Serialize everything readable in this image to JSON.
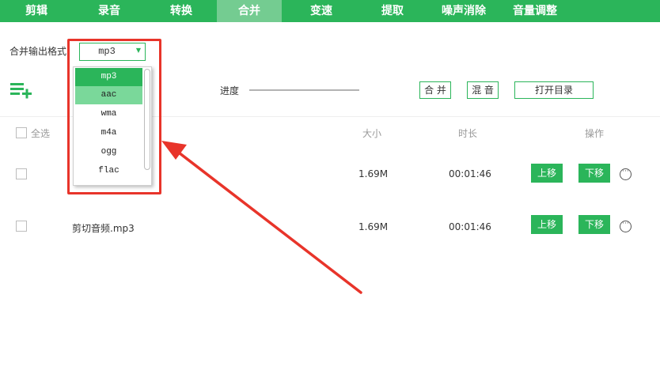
{
  "tabs": [
    {
      "label": "剪辑"
    },
    {
      "label": "录音"
    },
    {
      "label": "转换"
    },
    {
      "label": "合并",
      "active": true
    },
    {
      "label": "变速"
    },
    {
      "label": "提取"
    },
    {
      "label": "噪声消除"
    },
    {
      "label": "音量调整"
    }
  ],
  "format": {
    "label": "合并输出格式",
    "selected": "mp3"
  },
  "dropdown": {
    "options": [
      "mp3",
      "aac",
      "wma",
      "m4a",
      "ogg",
      "flac"
    ],
    "selected": "mp3",
    "hovered": "aac"
  },
  "toolbar": {
    "add_icon": "add-list-icon",
    "progress_label": "进度",
    "merge_label": "合 并",
    "mix_label": "混 音",
    "open_dir_label": "打开目录"
  },
  "table": {
    "headers": {
      "select_all": "全选",
      "size": "大小",
      "duration": "时长",
      "actions": "操作"
    },
    "rows": [
      {
        "name": "",
        "size": "1.69M",
        "duration": "00:01:46",
        "up": "上移",
        "down": "下移"
      },
      {
        "name": "剪切音频.mp3",
        "size": "1.69M",
        "duration": "00:01:46",
        "up": "上移",
        "down": "下移"
      }
    ]
  },
  "colors": {
    "accent": "#2bb55a",
    "highlight": "#e8342a"
  }
}
